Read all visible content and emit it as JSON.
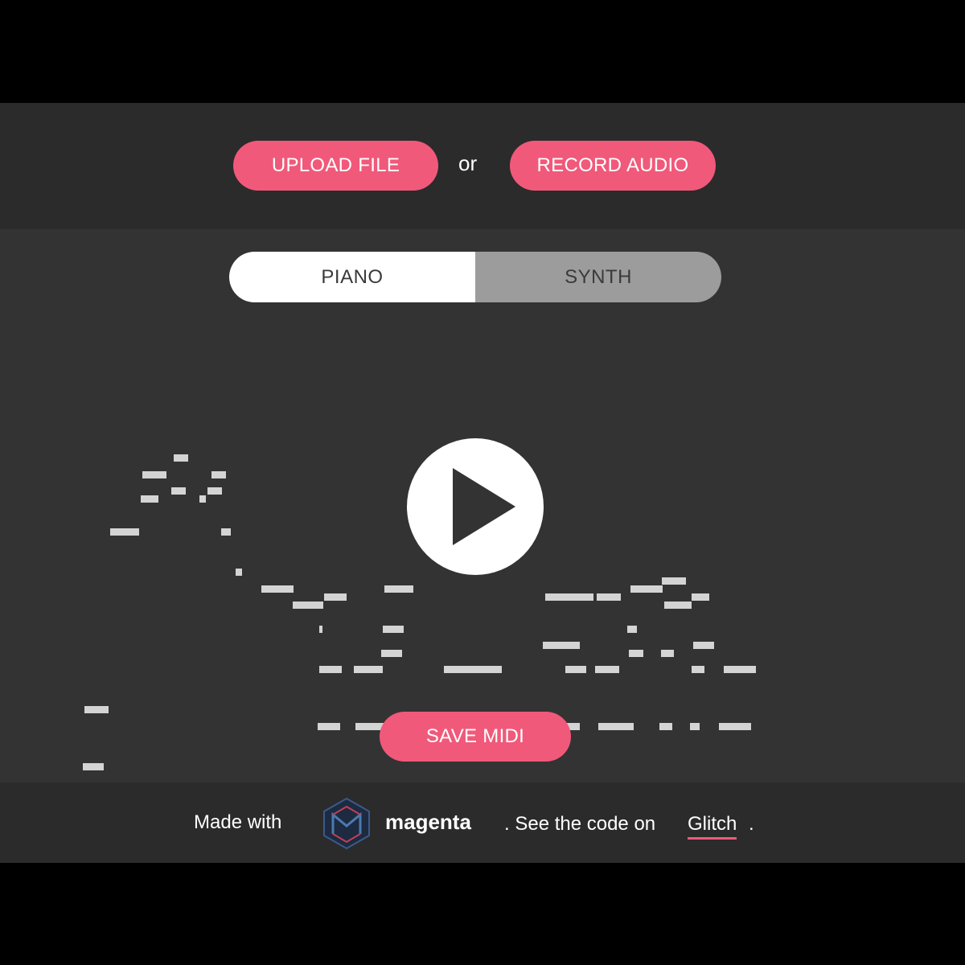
{
  "header": {
    "upload_label": "UPLOAD FILE",
    "or_label": "or",
    "record_label": "RECORD AUDIO"
  },
  "instrument_toggle": {
    "options": [
      "PIANO",
      "SYNTH"
    ],
    "selected": "PIANO"
  },
  "player": {
    "play_icon": "play-icon"
  },
  "actions": {
    "save_label": "SAVE MIDI"
  },
  "footer": {
    "made_with": "Made with",
    "brand": "magenta",
    "see_code": ". See the code on",
    "link_label": "Glitch",
    "end_dot": ".",
    "logo_icon": "magenta-logo-icon"
  },
  "colors": {
    "accent": "#f0597a",
    "background": "#333333",
    "note": "#d4d4d4"
  }
}
